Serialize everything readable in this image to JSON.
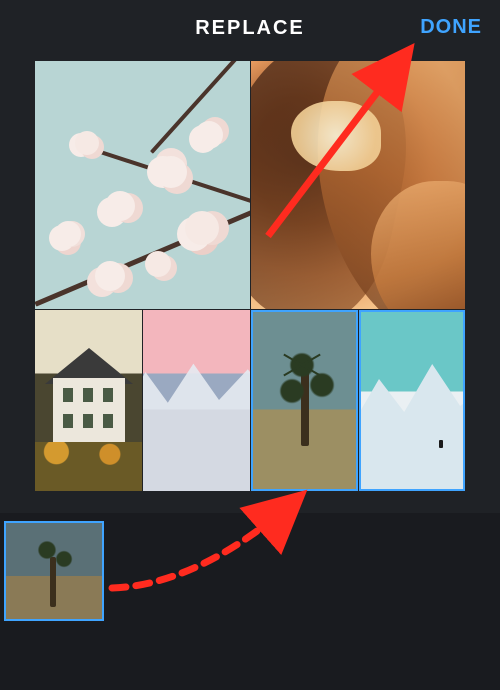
{
  "header": {
    "title": "REPLACE",
    "done_label": "DONE"
  },
  "accent_color": "#3fa4ff",
  "annotation_color": "#ff2b1f",
  "collage": {
    "slots": [
      {
        "id": "top-left",
        "subject": "cherry-blossoms",
        "selected": false
      },
      {
        "id": "top-right",
        "subject": "sandstone-canyon",
        "selected": false
      },
      {
        "id": "bottom-1",
        "subject": "house-autumn",
        "selected": false
      },
      {
        "id": "bottom-2",
        "subject": "alpenglow-ridge",
        "selected": false
      },
      {
        "id": "bottom-3",
        "subject": "joshua-tree",
        "selected": true
      },
      {
        "id": "bottom-4",
        "subject": "snow-peaks",
        "selected": true
      }
    ]
  },
  "tray": {
    "thumbnails": [
      {
        "subject": "joshua-tree",
        "selected": true
      }
    ]
  },
  "annotations": [
    {
      "kind": "arrow-solid",
      "from": "collage-center",
      "to": "done-button"
    },
    {
      "kind": "arrow-dashed",
      "from": "tray-thumbnail",
      "to": "collage-slot-bottom-3"
    }
  ]
}
